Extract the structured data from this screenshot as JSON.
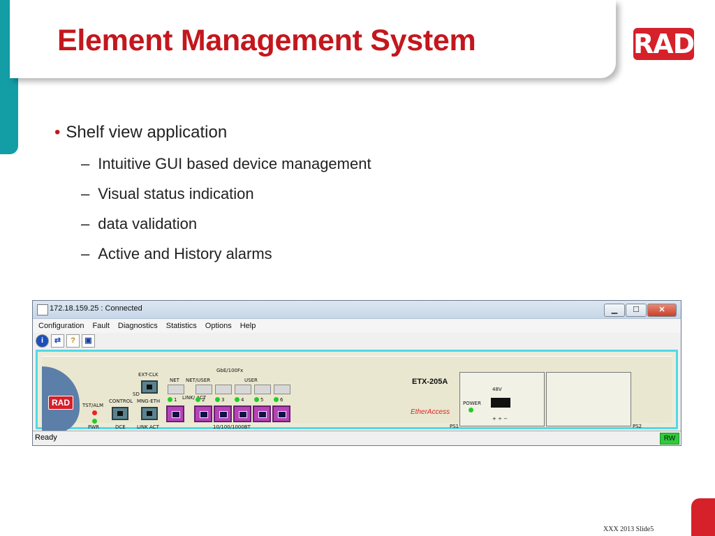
{
  "slide": {
    "title": "Element Management System",
    "logo_text": "RAD",
    "bullets": [
      {
        "text": "Shelf view application"
      },
      {
        "text": "Intuitive GUI based device management"
      },
      {
        "text": "Visual status indication"
      },
      {
        "text": "data validation"
      },
      {
        "text": "Active and History alarms"
      }
    ],
    "bullet_marker": "•",
    "dash_marker": "–",
    "footer": "XXX 2013  Slide5",
    "colors": {
      "accent": "#c3171d",
      "teal": "#139ea6",
      "brand_red": "#d6202a"
    }
  },
  "window": {
    "title": "172.18.159.25 : Connected",
    "buttons": {
      "minimize": "▁",
      "maximize": "☐",
      "close": "✕"
    },
    "menu": [
      "Configuration",
      "Fault",
      "Diagnostics",
      "Statistics",
      "Options",
      "Help"
    ],
    "toolbar_icons": [
      "info-icon",
      "connect-icon",
      "help-icon",
      "save-icon"
    ],
    "toolbar_glyphs": [
      "i",
      "⇄",
      "?",
      "▣"
    ],
    "status": "Ready",
    "mode": "RW"
  },
  "device": {
    "brand_tag": "RAD",
    "model": "ETX-205A",
    "ether_logo": "EtherAccess",
    "labels": {
      "ext_clk": "EXT-CLK",
      "sd": "SD",
      "tst_alm": "TST/ALM",
      "pwr": "PWR",
      "control": "CONTROL",
      "dce": "DCE",
      "mng_eth": "MNG-ETH",
      "link_act": "LINK ACT",
      "gbe": "GbE/100Fx",
      "net": "NET",
      "net_user": "NET/USER",
      "user": "USER",
      "link_act2": "LINK/ ACT",
      "copper": "10/100/1000BT",
      "v48": "48V",
      "power": "POWER",
      "terminals": "+ ÷ −",
      "ps1": "PS1",
      "ps2": "PS2"
    },
    "ports": [
      "1",
      "2",
      "3",
      "4",
      "5",
      "6"
    ]
  }
}
